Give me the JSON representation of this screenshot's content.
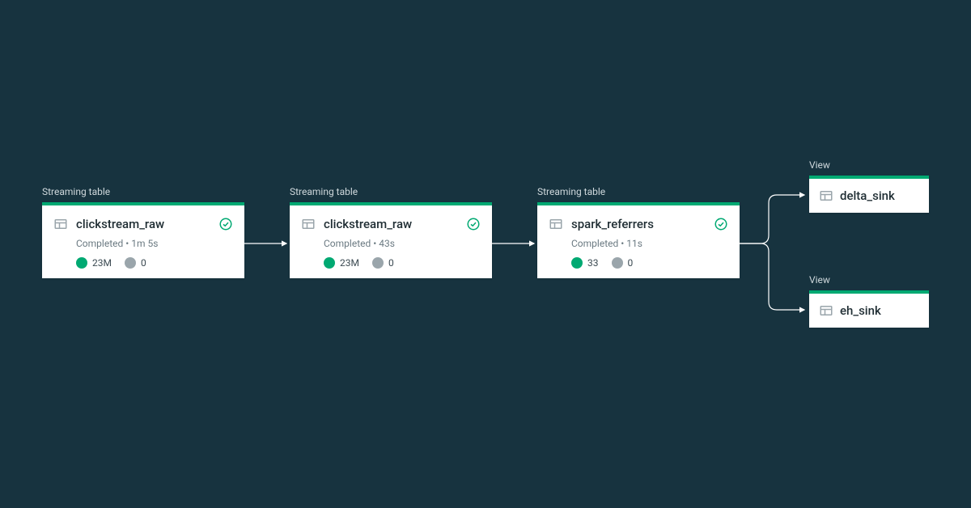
{
  "nodes": {
    "n1": {
      "type_label": "Streaming table",
      "title": "clickstream_raw",
      "status": "Completed • 1m 5s",
      "metric_green": "23M",
      "metric_gray": "0"
    },
    "n2": {
      "type_label": "Streaming table",
      "title": "clickstream_raw",
      "status": "Completed • 43s",
      "metric_green": "23M",
      "metric_gray": "0"
    },
    "n3": {
      "type_label": "Streaming table",
      "title": "spark_referrers",
      "status": "Completed • 11s",
      "metric_green": "33",
      "metric_gray": "0"
    },
    "n4": {
      "type_label": "View",
      "title": "delta_sink"
    },
    "n5": {
      "type_label": "View",
      "title": "eh_sink"
    }
  },
  "colors": {
    "background": "#17333f",
    "accent": "#00a972",
    "muted": "#9aa5ab"
  }
}
